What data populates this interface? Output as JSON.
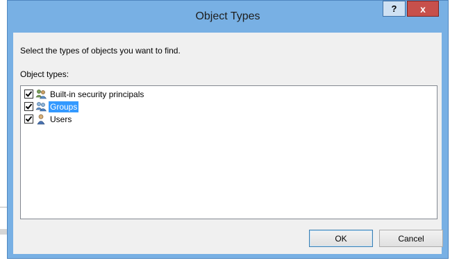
{
  "window": {
    "title": "Object Types",
    "help_label": "?",
    "close_label": "x"
  },
  "instruction": "Select the types of objects you want to find.",
  "list_label": "Object types:",
  "items": [
    {
      "label": "Built-in security principals",
      "checked": true,
      "icon": "security-principals-icon",
      "selected": false
    },
    {
      "label": "Groups",
      "checked": true,
      "icon": "groups-icon",
      "selected": true
    },
    {
      "label": "Users",
      "checked": true,
      "icon": "user-icon",
      "selected": false
    }
  ],
  "buttons": {
    "ok_label": "OK",
    "cancel_label": "Cancel"
  },
  "colors": {
    "title_bar": "#78b0e4",
    "close_button": "#c7504b",
    "selection": "#3399ff",
    "client_background": "#f0f0f0"
  }
}
